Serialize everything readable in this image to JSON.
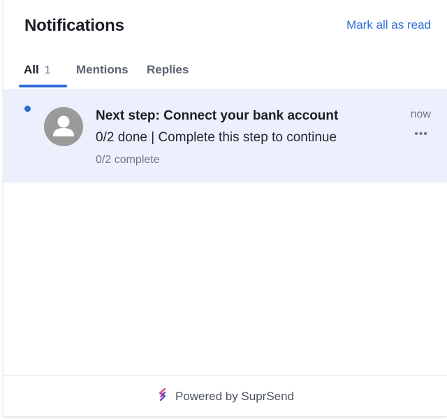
{
  "header": {
    "title": "Notifications",
    "mark_all_label": "Mark all as read"
  },
  "tabs": [
    {
      "label": "All",
      "count": "1",
      "active": true
    },
    {
      "label": "Mentions"
    },
    {
      "label": "Replies"
    }
  ],
  "notifications": [
    {
      "unread": true,
      "avatar_icon": "user-avatar-icon",
      "title": "Next step: Connect your bank account",
      "body": "0/2 done | Complete this step to continue",
      "subtext": "0/2 complete",
      "time": "now",
      "more_icon": "more-horizontal-icon"
    }
  ],
  "footer": {
    "powered_by": "Powered by SuprSend",
    "logo_icon": "suprsend-logo-icon"
  },
  "colors": {
    "accent": "#2f6bd6",
    "unread_bg": "#ebf0fc",
    "text": "#1b1d26",
    "muted": "#6f7686"
  }
}
